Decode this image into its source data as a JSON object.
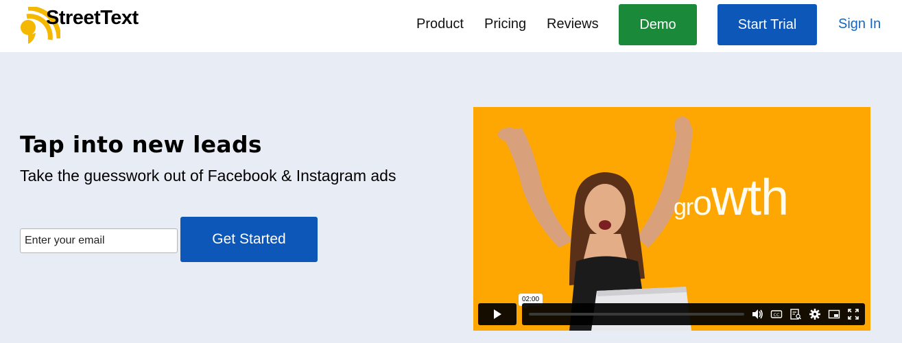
{
  "brand": {
    "name": "StreetText",
    "logo_color": "#f5b800"
  },
  "nav": {
    "product": "Product",
    "pricing": "Pricing",
    "reviews": "Reviews",
    "demo": "Demo",
    "start_trial": "Start Trial",
    "sign_in": "Sign In"
  },
  "hero": {
    "title": "Tap into new leads",
    "subtitle": "Take the guesswork out of Facebook & Instagram ads",
    "email_placeholder": "Enter your email",
    "cta": "Get Started"
  },
  "video": {
    "word_parts": [
      "gr",
      "o",
      "wth"
    ],
    "time_tooltip": "02:00",
    "progress": 0,
    "background_color": "#fea703"
  },
  "colors": {
    "primary_blue": "#0c57b8",
    "demo_green": "#1a8a3a",
    "link_blue": "#1266c4",
    "page_bg": "#e8edf5"
  }
}
